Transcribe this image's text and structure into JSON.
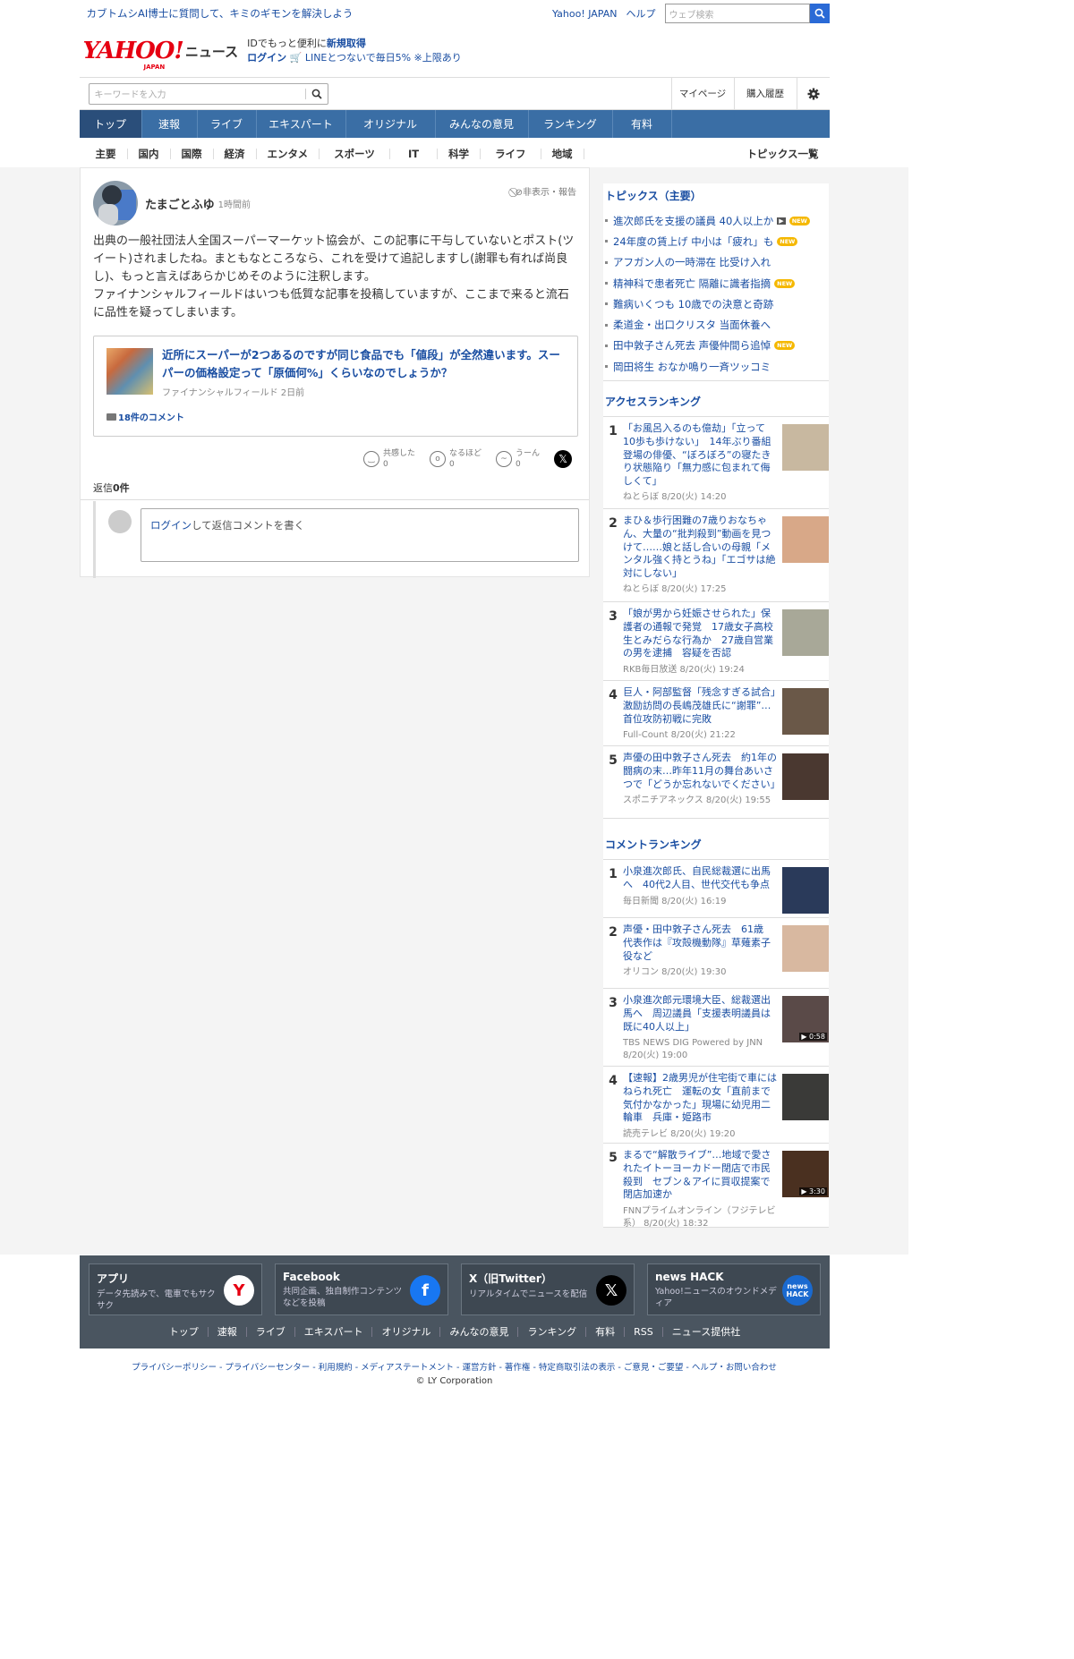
{
  "promo": {
    "text": "カブトムシAI博士に質問して、キミのギモンを解決しよう",
    "yahoo_japan": "Yahoo! JAPAN",
    "help": "ヘルプ",
    "web_search_placeholder": "ウェブ検索"
  },
  "logo": {
    "brand": "YAHOO!",
    "japan": "JAPAN",
    "news": "ニュース"
  },
  "account": {
    "id_text": "IDでもっと便利に",
    "signup": "新規取得",
    "login": "ログイン",
    "line_text": "LINEとつないで毎日5% ※上限あり"
  },
  "search": {
    "placeholder": "キーワードを入力",
    "mypage": "マイページ",
    "purchase": "購入履歴"
  },
  "main_nav": [
    "トップ",
    "速報",
    "ライブ",
    "エキスパート",
    "オリジナル",
    "みんなの意見",
    "ランキング",
    "有料"
  ],
  "sub_nav": [
    "主要",
    "国内",
    "国際",
    "経済",
    "エンタメ",
    "スポーツ",
    "IT",
    "科学",
    "ライフ",
    "地域"
  ],
  "topics_list_label": "トピックス一覧",
  "comment": {
    "author": "たまごとふゆ",
    "time": "1時間前",
    "hide_report": "非表示・報告",
    "body_1": "出典の一般社団法人全国スーパーマーケット協会が、この記事に干与していないとポスト(ツイート)されましたね。まともなところなら、これを受けて追記しますし(謝罪も有れば尚良し)、もっと言えばあらかじめそのように注釈します。",
    "body_2": "ファイナンシャルフィールドはいつも低質な記事を投稿していますが、ここまで来ると流石に品性を疑ってしまいます。",
    "article_title": "近所にスーパーが2つあるのですが同じ食品でも「値段」が全然違います。スーパーの価格設定って「原価何%」くらいなのでしょうか？",
    "article_source": "ファイナンシャルフィールド 2日前",
    "article_comments": "18件のコメント",
    "reactions": [
      {
        "label": "共感した",
        "count": "0"
      },
      {
        "label": "なるほど",
        "count": "0"
      },
      {
        "label": "うーん",
        "count": "0"
      }
    ],
    "replies_prefix": "返信",
    "replies_count": "0件",
    "reply_login": "ログイン",
    "reply_placeholder": "して返信コメントを書く"
  },
  "topics": {
    "title": "トピックス（主要）",
    "items": [
      {
        "text": "進次郎氏を支援の議員 40人以上か",
        "video": true,
        "new": true
      },
      {
        "text": "24年度の賃上げ 中小は「疲れ」も",
        "new": true
      },
      {
        "text": "アフガン人の一時滞在 比受け入れ"
      },
      {
        "text": "精神科で患者死亡 隔離に識者指摘",
        "new": true
      },
      {
        "text": "難病いくつも 10歳での決意と奇跡"
      },
      {
        "text": "柔道金・出口クリスタ 当面休養へ"
      },
      {
        "text": "田中敦子さん死去 声優仲間ら追悼",
        "new": true
      },
      {
        "text": "岡田将生 おなか鳴り一斉ツッコミ"
      }
    ],
    "new_label": "NEW",
    "video_label": "▶"
  },
  "access_ranking": {
    "title": "アクセスランキング",
    "items": [
      {
        "rank": "1",
        "title": "「お風呂入るのも億劫」「立って10歩も歩けない」　14年ぶり番組登場の俳優、“ぼろぼろ”の寝たきり状態陥り「無力感に包まれて侮しくて」",
        "meta": "ねとらぼ 8/20(火) 14:20",
        "color": "#c8b8a0"
      },
      {
        "rank": "2",
        "title": "まひ＆歩行困難の7歳りおなちゃん、大量の“批判殺到”動画を見つけて……娘と話し合いの母親「メンタル強く持とうね」「エゴサは絶対にしない」",
        "meta": "ねとらぼ 8/20(火) 17:25",
        "color": "#d8a888"
      },
      {
        "rank": "3",
        "title": "「娘が男から妊娠させられた」保護者の通報で発覚　17歳女子高校生とみだらな行為か　27歳自営業の男を逮捕　容疑を否認",
        "meta": "RKB毎日放送 8/20(火) 19:24",
        "color": "#a8a898"
      },
      {
        "rank": "4",
        "title": "巨人・阿部監督「残念すぎる試合」　激励訪問の長嶋茂雄氏に“謝罪”…首位攻防初戦に完敗",
        "meta": "Full-Count 8/20(火) 21:22",
        "color": "#6a5848"
      },
      {
        "rank": "5",
        "title": "声優の田中敦子さん死去　約1年の闘病の末…昨年11月の舞台あいさつで「どうか忘れないでください」",
        "meta": "スポニチアネックス 8/20(火) 19:55",
        "color": "#4a3830"
      }
    ]
  },
  "comment_ranking": {
    "title": "コメントランキング",
    "items": [
      {
        "rank": "1",
        "title": "小泉進次郎氏、自民総裁選に出馬へ　40代2人目、世代交代も争点",
        "meta": "毎日新聞 8/20(火) 16:19",
        "color": "#2a3a5a"
      },
      {
        "rank": "2",
        "title": "声優・田中敦子さん死去　61歳　代表作は『攻殻機動隊』草薙素子役など",
        "meta": "オリコン 8/20(火) 19:30",
        "color": "#d8b8a0"
      },
      {
        "rank": "3",
        "title": "小泉進次郎元環境大臣、総裁選出馬へ　周辺議員「支援表明議員は既に40人以上」",
        "meta": "TBS NEWS DIG Powered by JNN 8/20(火) 19:00",
        "color": "#5a4a48",
        "duration": "▶ 0:58"
      },
      {
        "rank": "4",
        "title": "【速報】2歳男児が住宅街で車にはねられ死亡　運転の女「直前まで気付かなかった」現場に幼児用二輪車　兵庫・姫路市",
        "meta": "読売テレビ 8/20(火) 19:20",
        "color": "#3a3a38"
      },
      {
        "rank": "5",
        "title": "まるで“解散ライブ”…地域で愛されたイトーヨーカドー閉店で市民殺到　セブン＆アイに買収提案で閉店加速か",
        "meta": "FNNプライムオンライン（フジテレビ系） 8/20(火) 18:32",
        "color": "#4a3020",
        "duration": "▶ 3:30"
      }
    ]
  },
  "footer": {
    "cards": [
      {
        "title": "アプリ",
        "desc": "データ先読みで、電車でもサクサク",
        "icon": "Y",
        "bg": "#ffffff",
        "fg": "#e60012"
      },
      {
        "title": "Facebook",
        "desc": "共同企画、独自制作コンテンツなどを投稿",
        "icon": "f",
        "bg": "#1877f2",
        "fg": "#ffffff"
      },
      {
        "title": "X（旧Twitter）",
        "desc": "リアルタイムでニュースを配信",
        "icon": "𝕏",
        "bg": "#000000",
        "fg": "#ffffff"
      },
      {
        "title": "news HACK",
        "desc": "Yahoo!ニュースのオウンドメディア",
        "icon": "news HACK",
        "bg": "#1a6ad0",
        "fg": "#ffffff"
      }
    ],
    "links": [
      "トップ",
      "速報",
      "ライブ",
      "エキスパート",
      "オリジナル",
      "みんなの意見",
      "ランキング",
      "有料",
      "RSS",
      "ニュース提供社"
    ],
    "legal": "プライバシーポリシー - プライバシーセンター - 利用規約 - メディアステートメント - 運営方針 - 著作権 - 特定商取引法の表示 - ご意見・ご要望 - ヘルプ・お問い合わせ",
    "copyright": "© LY Corporation"
  }
}
